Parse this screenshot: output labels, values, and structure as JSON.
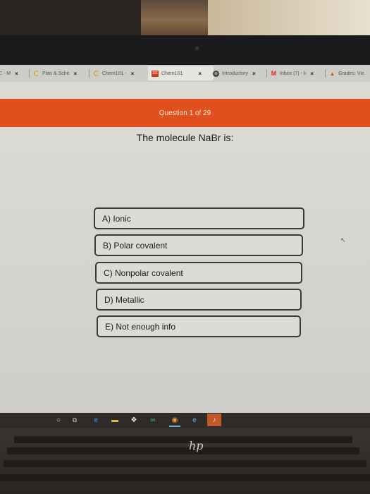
{
  "browser": {
    "tabs": [
      {
        "label": "C - M",
        "icon": "page-icon",
        "active": false
      },
      {
        "label": "Plan & Sche",
        "icon": "spinner-icon",
        "active": false
      },
      {
        "label": "Chem101 - ",
        "icon": "spinner-icon",
        "active": false
      },
      {
        "label": "Chem101",
        "icon": "app-101-icon",
        "active": true
      },
      {
        "label": "Introductory",
        "icon": "globe-icon",
        "active": false
      },
      {
        "label": "Inbox (7) - k",
        "icon": "gmail-icon",
        "active": false
      },
      {
        "label": "Grades: Vie",
        "icon": "graduation-cap-icon",
        "active": false
      }
    ],
    "close_glyph": "×",
    "app_icon_text": "101"
  },
  "quiz": {
    "progress_label": "Question 1 of 29",
    "current_question": 1,
    "total_questions": 29,
    "question": "The molecule NaBr is:",
    "options": [
      {
        "label": "A) Ionic"
      },
      {
        "label": "B) Polar covalent"
      },
      {
        "label": "C) Nonpolar covalent"
      },
      {
        "label": "D) Metallic"
      },
      {
        "label": "E) Not enough info"
      }
    ],
    "accent_color": "#e0501e"
  },
  "taskbar": {
    "items": [
      {
        "name": "cortana-icon",
        "glyph": "○"
      },
      {
        "name": "task-view-icon",
        "glyph": "⧉"
      },
      {
        "name": "edge-icon",
        "glyph": "e"
      },
      {
        "name": "file-explorer-icon",
        "glyph": "▬"
      },
      {
        "name": "dropbox-icon",
        "glyph": "❖"
      },
      {
        "name": "infinity-app-icon",
        "glyph": "∞"
      },
      {
        "name": "chrome-icon",
        "glyph": "◉"
      },
      {
        "name": "internet-explorer-icon",
        "glyph": "e"
      },
      {
        "name": "itunes-icon",
        "glyph": "♪"
      }
    ]
  },
  "laptop": {
    "brand_logo": "hp"
  },
  "cursor_glyph": "↖"
}
